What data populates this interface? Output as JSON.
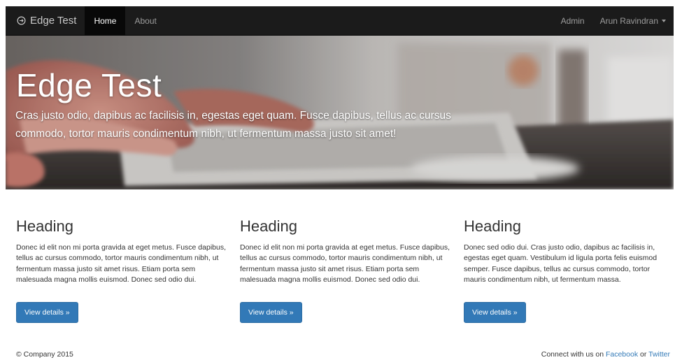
{
  "navbar": {
    "brand": "Edge Test",
    "brand_icon": "circle-arrow-icon",
    "items": [
      {
        "label": "Home",
        "active": true
      },
      {
        "label": "About",
        "active": false
      }
    ],
    "right_items": [
      {
        "label": "Admin"
      },
      {
        "label": "Arun Ravindran"
      }
    ]
  },
  "hero": {
    "title": "Edge Test",
    "text": "Cras justo odio, dapibus ac facilisis in, egestas eget quam. Fusce dapibus, tellus ac cursus commodo, tortor mauris condimentum nibh, ut fermentum massa justo sit amet!"
  },
  "columns": [
    {
      "heading": "Heading",
      "text": "Donec id elit non mi porta gravida at eget metus. Fusce dapibus, tellus ac cursus commodo, tortor mauris condimentum nibh, ut fermentum massa justo sit amet risus. Etiam porta sem malesuada magna mollis euismod. Donec sed odio dui.",
      "button": "View details »"
    },
    {
      "heading": "Heading",
      "text": "Donec id elit non mi porta gravida at eget metus. Fusce dapibus, tellus ac cursus commodo, tortor mauris condimentum nibh, ut fermentum massa justo sit amet risus. Etiam porta sem malesuada magna mollis euismod. Donec sed odio dui.",
      "button": "View details »"
    },
    {
      "heading": "Heading",
      "text": "Donec sed odio dui. Cras justo odio, dapibus ac facilisis in, egestas eget quam. Vestibulum id ligula porta felis euismod semper. Fusce dapibus, tellus ac cursus commodo, tortor mauris condimentum nibh, ut fermentum massa.",
      "button": "View details »"
    }
  ],
  "footer": {
    "copyright": "© Company 2015",
    "connect_prefix": "Connect with us on ",
    "facebook": "Facebook",
    "or": " or ",
    "twitter": "Twitter"
  },
  "colors": {
    "navbar_bg": "#1b1b1b",
    "active_tab_bg": "#080808",
    "button_primary": "#3279b7",
    "link": "#337ab7"
  }
}
